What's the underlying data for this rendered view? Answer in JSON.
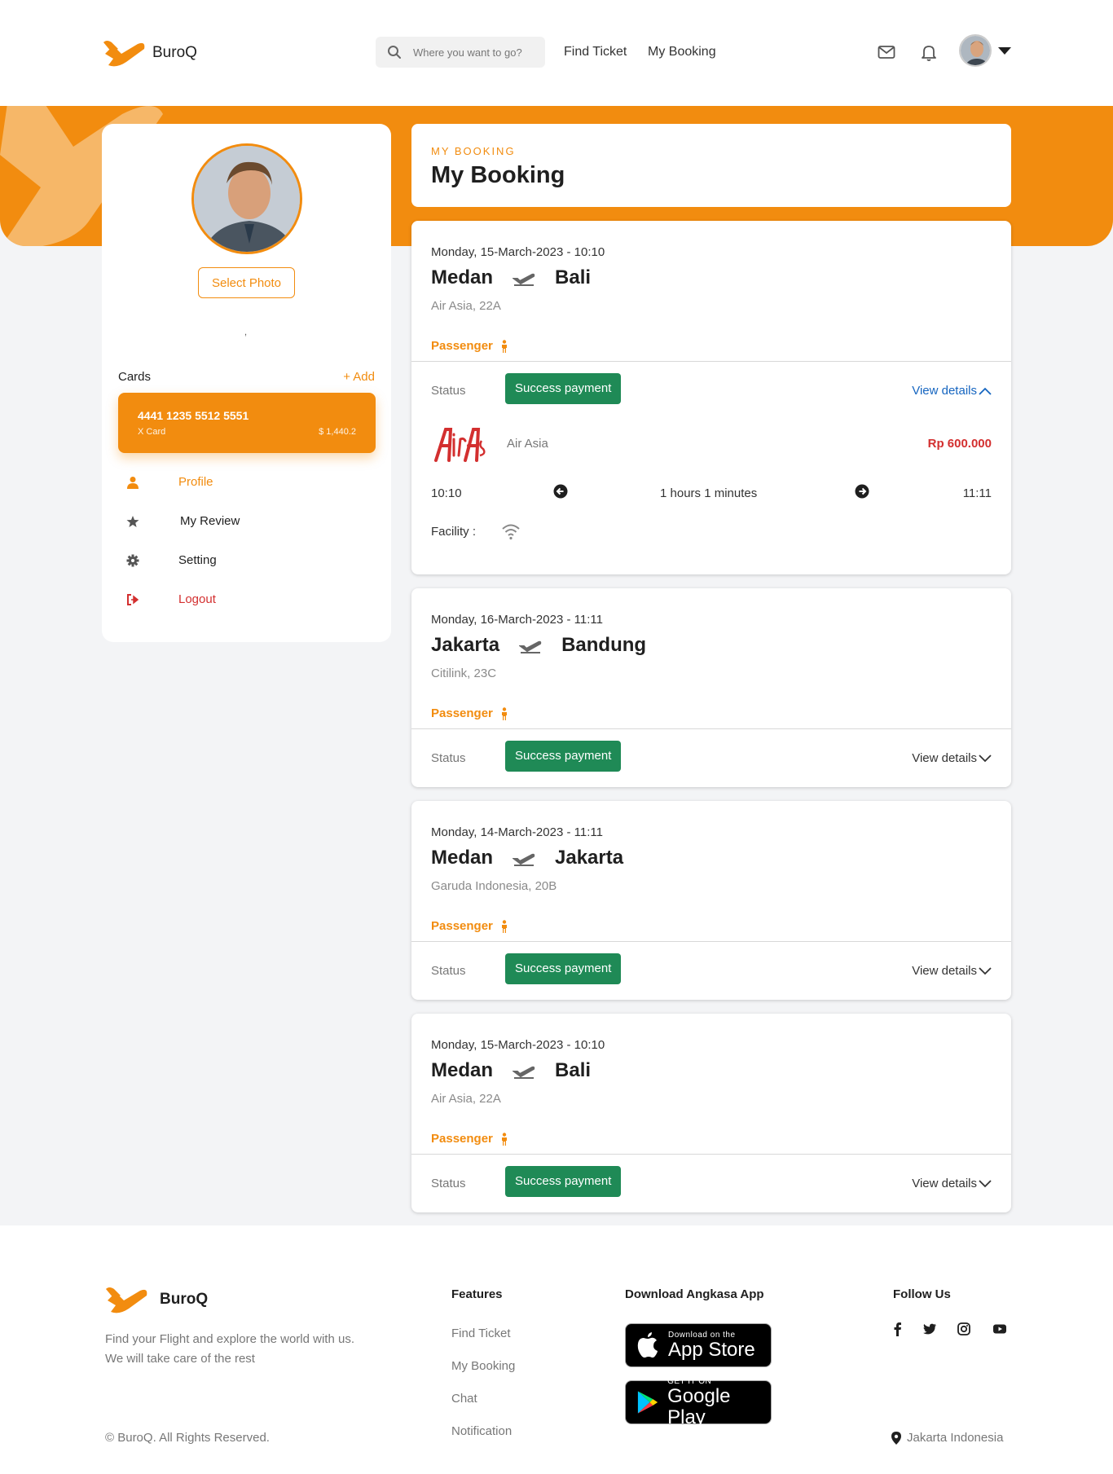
{
  "brand": {
    "name": "BuroQ",
    "accent_color": "#f28c0f"
  },
  "header": {
    "search_placeholder": "Where you want to go?",
    "nav": [
      "Find Ticket",
      "My Booking"
    ],
    "icons": [
      "mail-icon",
      "bell-icon"
    ]
  },
  "sidebar": {
    "select_photo_label": "Select Photo",
    "name_placeholder": ",",
    "cards_label": "Cards",
    "add_label": "+ Add",
    "card": {
      "number": "4441 1235 5512 5551",
      "type": "X Card",
      "balance": "$ 1,440.2"
    },
    "menu": [
      {
        "label": "Profile",
        "icon": "user-icon"
      },
      {
        "label": "My Review",
        "icon": "star-icon"
      },
      {
        "label": "Setting",
        "icon": "gear-icon"
      },
      {
        "label": "Logout",
        "icon": "logout-icon"
      }
    ]
  },
  "page": {
    "eyebrow": "MY BOOKING",
    "title": "My Booking"
  },
  "status_label": "Status",
  "passenger_label": "Passenger",
  "bookings": [
    {
      "date": "Monday, 15-March-2023 - 10:10",
      "from": "Medan",
      "to": "Bali",
      "airline_seat": "Air Asia, 22A",
      "status": "Success payment",
      "view_label": "View details",
      "expanded": true,
      "details": {
        "airline": "Air Asia",
        "price": "Rp 600.000",
        "departure": "10:10",
        "duration": "1 hours 1 minutes",
        "arrival": "11:11",
        "facility_label": "Facility :"
      }
    },
    {
      "date": "Monday, 16-March-2023 - 11:11",
      "from": "Jakarta",
      "to": "Bandung",
      "airline_seat": "Citilink, 23C",
      "status": "Success payment",
      "view_label": "View details",
      "expanded": false
    },
    {
      "date": "Monday, 14-March-2023 - 11:11",
      "from": "Medan",
      "to": "Jakarta",
      "airline_seat": "Garuda Indonesia, 20B",
      "status": "Success payment",
      "view_label": "View details",
      "expanded": false
    },
    {
      "date": "Monday, 15-March-2023 - 10:10",
      "from": "Medan",
      "to": "Bali",
      "airline_seat": "Air Asia, 22A",
      "status": "Success payment",
      "view_label": "View details",
      "expanded": false
    }
  ],
  "footer": {
    "brand": "BuroQ",
    "tagline": "Find your Flight and explore the world with us. We will take care of the rest",
    "copyright": "© BuroQ. All Rights Reserved.",
    "features_title": "Features",
    "features": [
      "Find Ticket",
      "My Booking",
      "Chat",
      "Notification"
    ],
    "download_title": "Download Angkasa App",
    "app_store": {
      "small": "Download on the",
      "big": "App Store"
    },
    "google_play": {
      "small": "GET IT ON",
      "big": "Google Play"
    },
    "follow_title": "Follow Us",
    "social": [
      "facebook-icon",
      "twitter-icon",
      "instagram-icon",
      "youtube-icon"
    ],
    "location": "Jakarta Indonesia"
  }
}
